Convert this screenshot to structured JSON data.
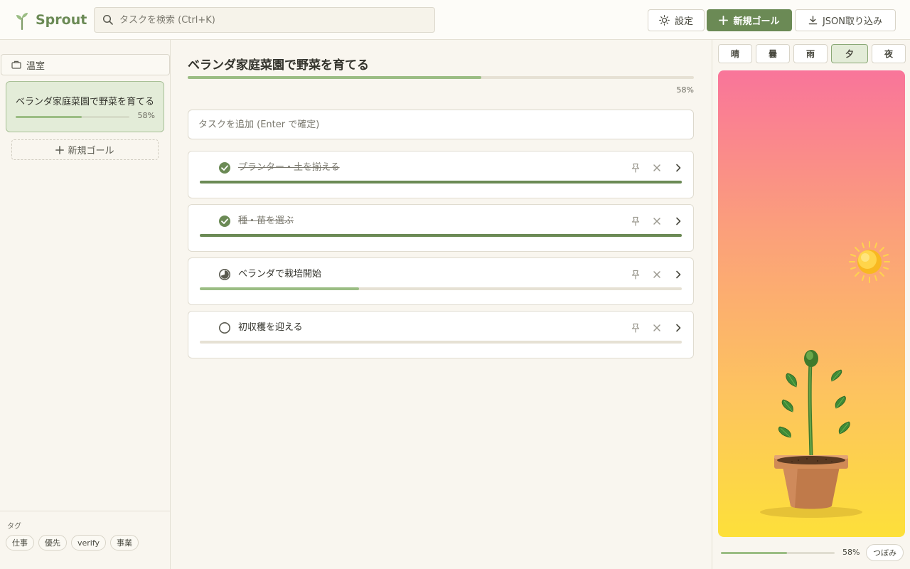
{
  "app": {
    "name": "Sprout"
  },
  "header": {
    "search_placeholder": "タスクを検索 (Ctrl+K)",
    "settings_label": "設定",
    "new_goal_label": "新規ゴール",
    "import_label": "JSON取り込み"
  },
  "sidebar": {
    "folder_label": "温室",
    "goals": [
      {
        "title": "ベランダ家庭菜園で野菜を育てる",
        "progress": 58,
        "progress_label": "58%"
      }
    ],
    "new_goal_label": "新規ゴール",
    "tags_label": "タグ",
    "tags": [
      "仕事",
      "優先",
      "verify",
      "事業"
    ]
  },
  "main": {
    "goal_title": "ベランダ家庭菜園で野菜を育てる",
    "progress": 58,
    "progress_label": "58%",
    "task_input_placeholder": "タスクを追加 (Enter で確定)",
    "tasks": [
      {
        "label": "プランター・土を揃える",
        "status": "done",
        "progress": 100
      },
      {
        "label": "種・苗を選ぶ",
        "status": "done",
        "progress": 100
      },
      {
        "label": "ベランダで栽培開始",
        "status": "in-progress",
        "progress": 33
      },
      {
        "label": "初収穫を迎える",
        "status": "todo",
        "progress": 0
      }
    ]
  },
  "garden": {
    "weather_tabs": [
      "晴",
      "曇",
      "雨",
      "夕",
      "夜"
    ],
    "active_weather": "夕",
    "progress": 58,
    "progress_label": "58%",
    "stage_label": "つぼみ"
  },
  "colors": {
    "accent": "#6b8a55",
    "progress_light": "#9bbd84",
    "progress_done": "#6b8a55",
    "sky_top": "#f9759a",
    "sky_bottom": "#fde03a"
  }
}
